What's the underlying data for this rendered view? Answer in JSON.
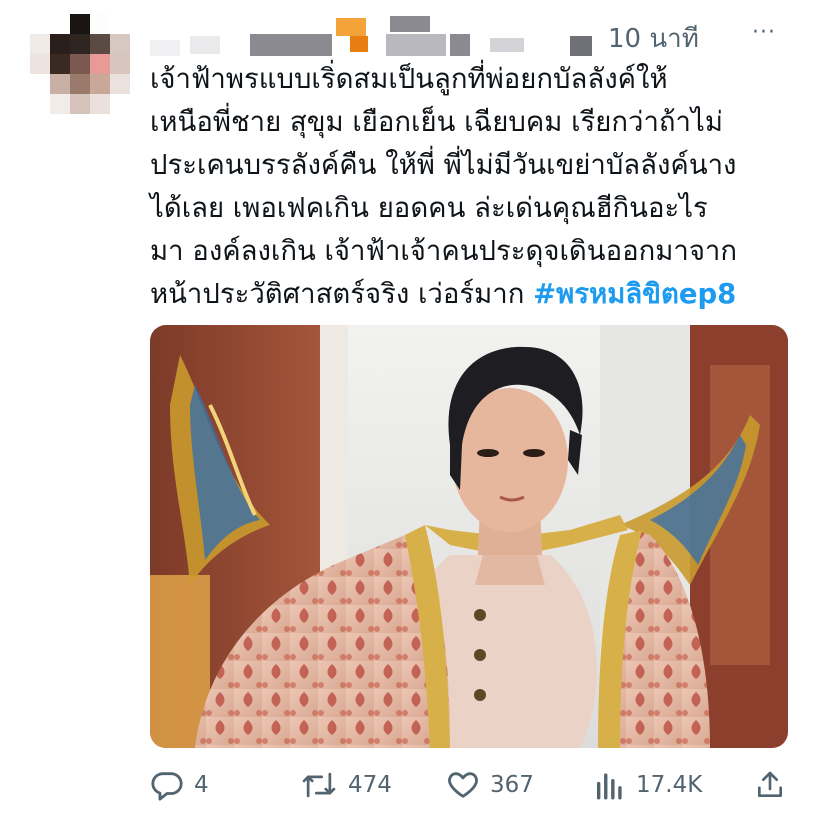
{
  "tweet": {
    "timestamp": "10 นาที",
    "more_label": "···",
    "text": "เจ้าฟ้าพรแบบเริ่ดสมเป็นลูกที่พ่อยกบัลลังค์ให้\nเหนือพี่ชาย สุขุม เยือกเย็น เฉียบคม เรียกว่าถ้าไม่\nประเคนบรรลังค์คืน ให้พี่ พี่ไม่มีวันเขย่าบัลลังค์นาง\nได้เลย เพอเฟคเกิน ยอดคน ล่ะเด่นคุณฮีกินอะไร\nมา องค์ลงเกิน เจ้าฟ้าเจ้าคนประดุจเดินออกมาจาก\nหน้าประวัติศาสตร์จริง เว่อร์มาก ",
    "hashtag": "#พรหมลิขิตep8"
  },
  "actions": {
    "reply": {
      "icon": "reply-icon",
      "count": "4"
    },
    "retweet": {
      "icon": "retweet-icon",
      "count": "474"
    },
    "like": {
      "icon": "heart-icon",
      "count": "367"
    },
    "views": {
      "icon": "views-icon",
      "count": "17.4K"
    },
    "share": {
      "icon": "share-icon"
    }
  },
  "colors": {
    "text": "#0f1419",
    "secondary": "#536471",
    "hashtag": "#1d9bf0"
  }
}
